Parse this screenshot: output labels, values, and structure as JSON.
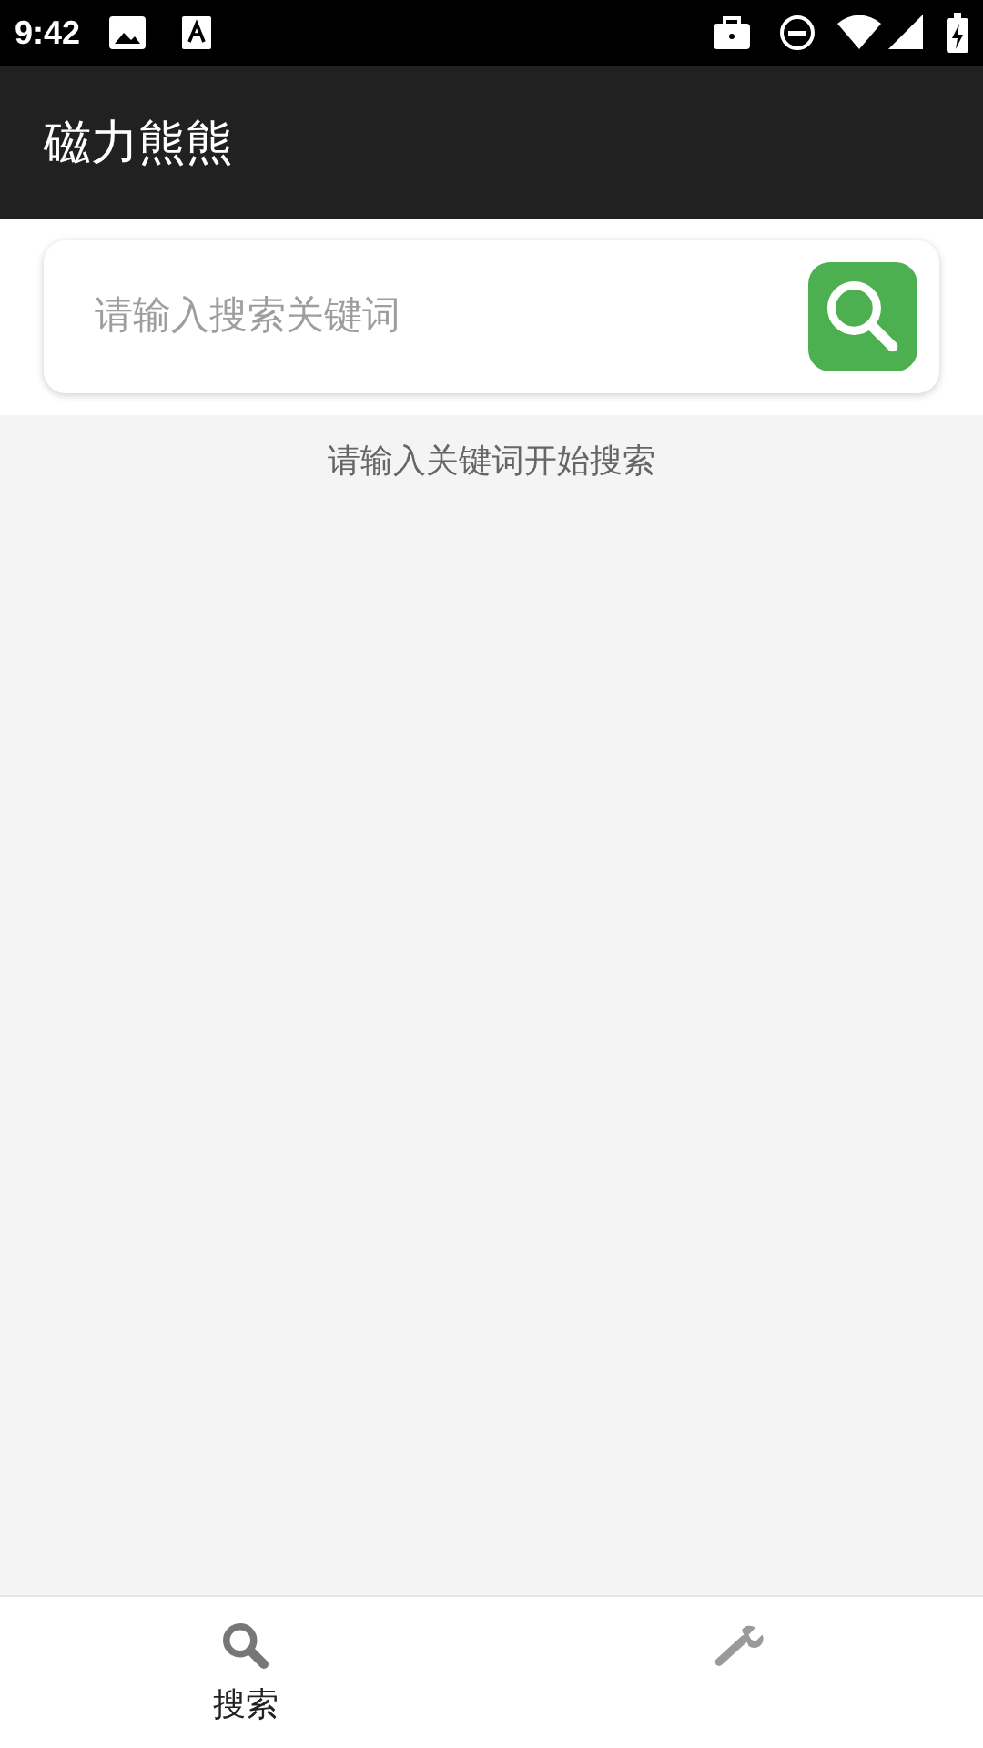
{
  "status_bar": {
    "time": "9:42"
  },
  "app_bar": {
    "title": "磁力熊熊"
  },
  "search": {
    "placeholder": "请输入搜索关键词"
  },
  "message": "请输入关键词开始搜索",
  "bottom_nav": [
    {
      "kind": "search",
      "label": "搜索",
      "selected": true
    },
    {
      "kind": "tools",
      "selected": false
    }
  ]
}
